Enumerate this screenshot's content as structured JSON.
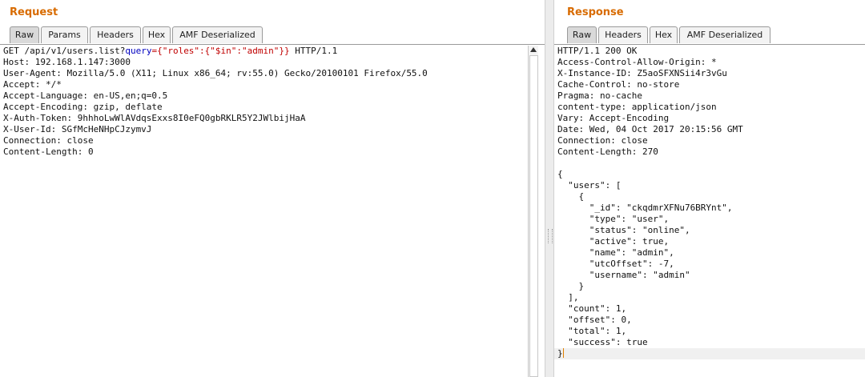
{
  "request": {
    "title": "Request",
    "tabs": [
      "Raw",
      "Params",
      "Headers",
      "Hex",
      "AMF Deserialized"
    ],
    "first_line": {
      "prefix": "GET /api/v1/users.list?",
      "param_name": "query",
      "param_value": "={\"roles\":{\"$in\":\"admin\"}}",
      "suffix": " HTTP/1.1"
    },
    "lines": [
      "Host: 192.168.1.147:3000",
      "User-Agent: Mozilla/5.0 (X11; Linux x86_64; rv:55.0) Gecko/20100101 Firefox/55.0",
      "Accept: */*",
      "Accept-Language: en-US,en;q=0.5",
      "Accept-Encoding: gzip, deflate",
      "X-Auth-Token: 9hhhoLwWlAVdqsExxs8I0eFQ0gbRKLR5Y2JWlbijHaA",
      "X-User-Id: SGfMcHeNHpCJzymvJ",
      "Connection: close",
      "Content-Length: 0"
    ]
  },
  "response": {
    "title": "Response",
    "tabs": [
      "Raw",
      "Headers",
      "Hex",
      "AMF Deserialized"
    ],
    "lines": [
      "HTTP/1.1 200 OK",
      "Access-Control-Allow-Origin: *",
      "X-Instance-ID: Z5aoSFXNSii4r3vGu",
      "Cache-Control: no-store",
      "Pragma: no-cache",
      "content-type: application/json",
      "Vary: Accept-Encoding",
      "Date: Wed, 04 Oct 2017 20:15:56 GMT",
      "Connection: close",
      "Content-Length: 270",
      "",
      "{",
      "  \"users\": [",
      "    {",
      "      \"_id\": \"ckqdmrXFNu76BRYnt\",",
      "      \"type\": \"user\",",
      "      \"status\": \"online\",",
      "      \"active\": true,",
      "      \"name\": \"admin\",",
      "      \"utcOffset\": -7,",
      "      \"username\": \"admin\"",
      "    }",
      "  ],",
      "  \"count\": 1,",
      "  \"offset\": 0,",
      "  \"total\": 1,",
      "  \"success\": true"
    ],
    "last_line": "}"
  },
  "colors": {
    "title": "#d86b00",
    "param_name": "#0000c0",
    "param_value": "#c00000",
    "caret": "#e08000"
  },
  "icons": [
    "scroll-up-arrow-icon",
    "splitter-grip-icon"
  ]
}
